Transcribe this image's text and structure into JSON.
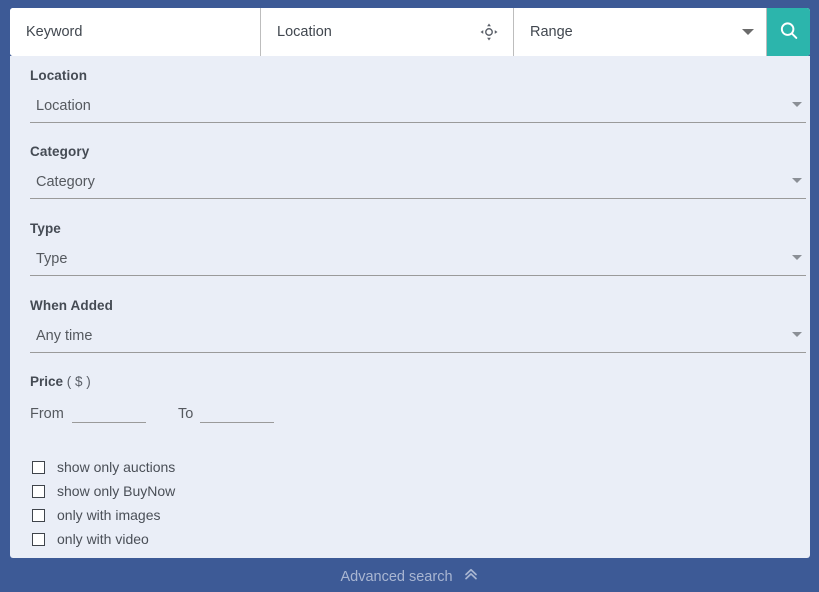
{
  "search_bar": {
    "keyword": {
      "value": "",
      "placeholder": "Keyword"
    },
    "location": {
      "value": "",
      "placeholder": "Location"
    },
    "range": {
      "value": "Range"
    },
    "locate_icon": "gps-crosshair-icon",
    "search_icon": "search-icon",
    "accent_color": "#2cb5ac"
  },
  "filters": [
    {
      "label": "Location",
      "value": "Location"
    },
    {
      "label": "Category",
      "value": "Category"
    },
    {
      "label": "Type",
      "value": "Type"
    },
    {
      "label": "When Added",
      "value": "Any time"
    }
  ],
  "price": {
    "title": "Price",
    "unit": "( $ )",
    "from_label": "From",
    "to_label": "To",
    "from_value": "",
    "to_value": ""
  },
  "checkboxes": [
    {
      "label": "show only auctions",
      "checked": false
    },
    {
      "label": "show only BuyNow",
      "checked": false
    },
    {
      "label": "only with images",
      "checked": false
    },
    {
      "label": "only with video",
      "checked": false
    }
  ],
  "footer": {
    "label": "Advanced search",
    "icon": "chevron-double-up-icon"
  },
  "colors": {
    "page_background": "#3d5a96",
    "panel_background": "#eaeef7",
    "accent": "#2cb5ac",
    "footer_text": "#a9b6d2"
  }
}
